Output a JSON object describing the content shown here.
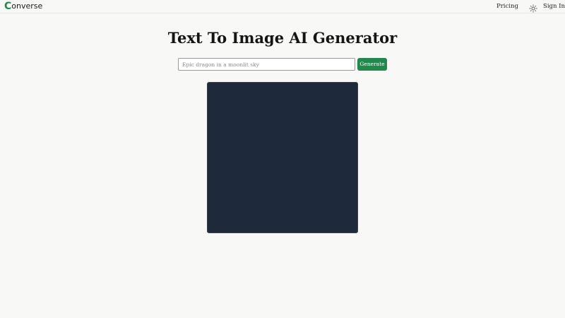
{
  "header": {
    "logo_initial": "C",
    "logo_rest": "onverse",
    "nav_pricing": "Pricing",
    "nav_signin": "Sign In",
    "theme_icon": "sun-icon"
  },
  "main": {
    "title": "Text To Image AI Generator",
    "prompt_placeholder": "Epic dragon in a moonlit sky",
    "prompt_value": "",
    "generate_label": "Generate"
  },
  "colors": {
    "brand_green": "#1f8a4c",
    "canvas_bg": "#1e293b",
    "page_bg": "#f8f8f7"
  }
}
